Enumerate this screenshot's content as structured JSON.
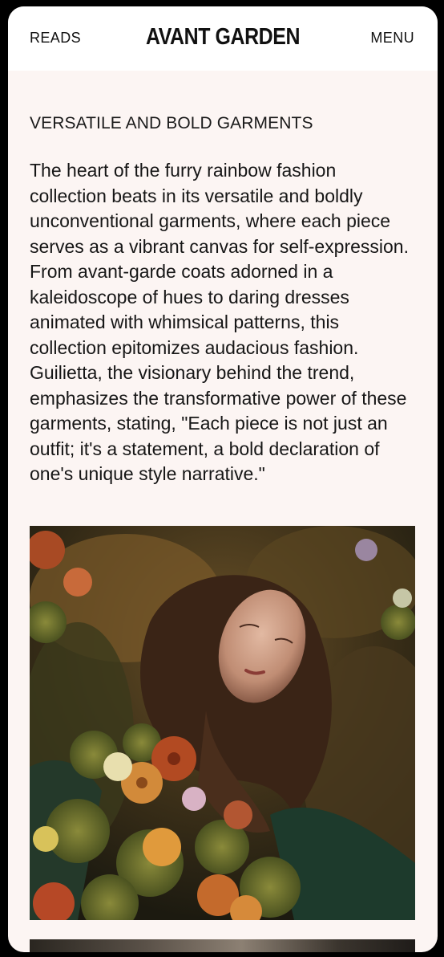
{
  "header": {
    "left_link": "READS",
    "brand": "AVANT GARDEN",
    "right_link": "MENU"
  },
  "article": {
    "heading": "VERSATILE AND BOLD GARMENTS",
    "body": "The heart of the furry rainbow fashion collection beats in its versatile and boldly unconventional garments, where each piece serves as a vibrant canvas for self-expression. From avant-garde coats adorned in a kaleidoscope of hues to daring dresses animated with whimsical patterns, this collection epitomizes audacious fashion. Guilietta, the visionary behind the trend, emphasizes the transformative power of these garments, stating, \"Each piece is not just an outfit; it's a statement, a bold declaration of one's unique style narrative.\""
  },
  "colors": {
    "page_background": "#fcf5f3",
    "header_background": "#ffffff",
    "text": "#161616"
  }
}
